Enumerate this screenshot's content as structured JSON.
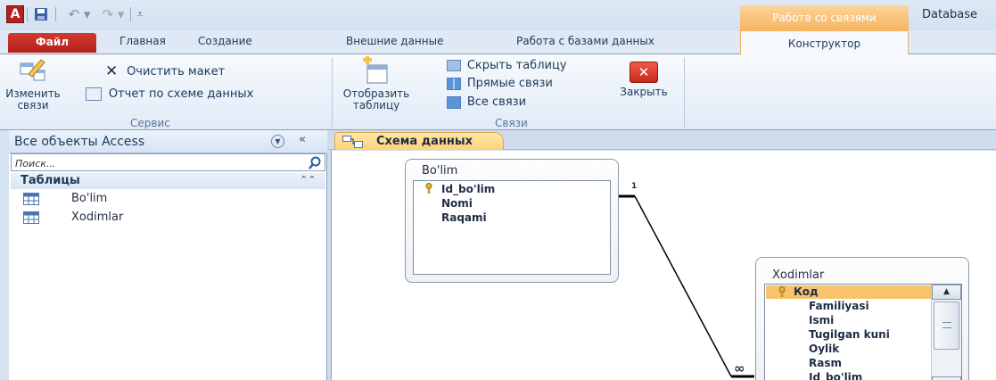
{
  "titlebar": {
    "app_logo": "A",
    "context_header": "Работа со связями",
    "app_title": "Database"
  },
  "tabs": {
    "file": "Файл",
    "home": "Главная",
    "create": "Создание",
    "external": "Внешние данные",
    "dbtools": "Работа с базами данных",
    "constructor": "Конструктор"
  },
  "ribbon": {
    "service": {
      "edit_relations_line1": "Изменить",
      "edit_relations_line2": "связи",
      "clear_layout": "Очистить макет",
      "schema_report": "Отчет по схеме данных",
      "group_label": "Сервис"
    },
    "relations": {
      "show_table_line1": "Отобразить",
      "show_table_line2": "таблицу",
      "hide_table": "Скрыть таблицу",
      "direct_relations": "Прямые связи",
      "all_relations": "Все связи",
      "close": "Закрыть",
      "group_label": "Связи"
    }
  },
  "nav": {
    "title": "Все объекты Access",
    "search_placeholder": "Поиск...",
    "group_title": "Таблицы",
    "items": [
      {
        "label": "Bo'lim",
        "icon": "table-icon"
      },
      {
        "label": "Xodimlar",
        "icon": "table-icon"
      }
    ]
  },
  "document": {
    "tab_label": "Схема данных",
    "tables": [
      {
        "name": "Bo'lim",
        "fields": [
          "Id_bo'lim",
          "Nomi",
          "Raqami"
        ],
        "primary_key": "Id_bo'lim"
      },
      {
        "name": "Xodimlar",
        "fields": [
          "Код",
          "Familiyasi",
          "Ismi",
          "Tugilgan kuni",
          "Oylik",
          "Rasm",
          "Id_bo'lim"
        ],
        "primary_key": "Код",
        "selected": "Код"
      }
    ],
    "relationship": {
      "one_side": "1",
      "many_side": "∞"
    }
  },
  "colors": {
    "file_tab": "#c42b20",
    "context_tab": "#f6b562",
    "doc_tab": "#ffd277",
    "selected_row": "#f8c36b"
  }
}
